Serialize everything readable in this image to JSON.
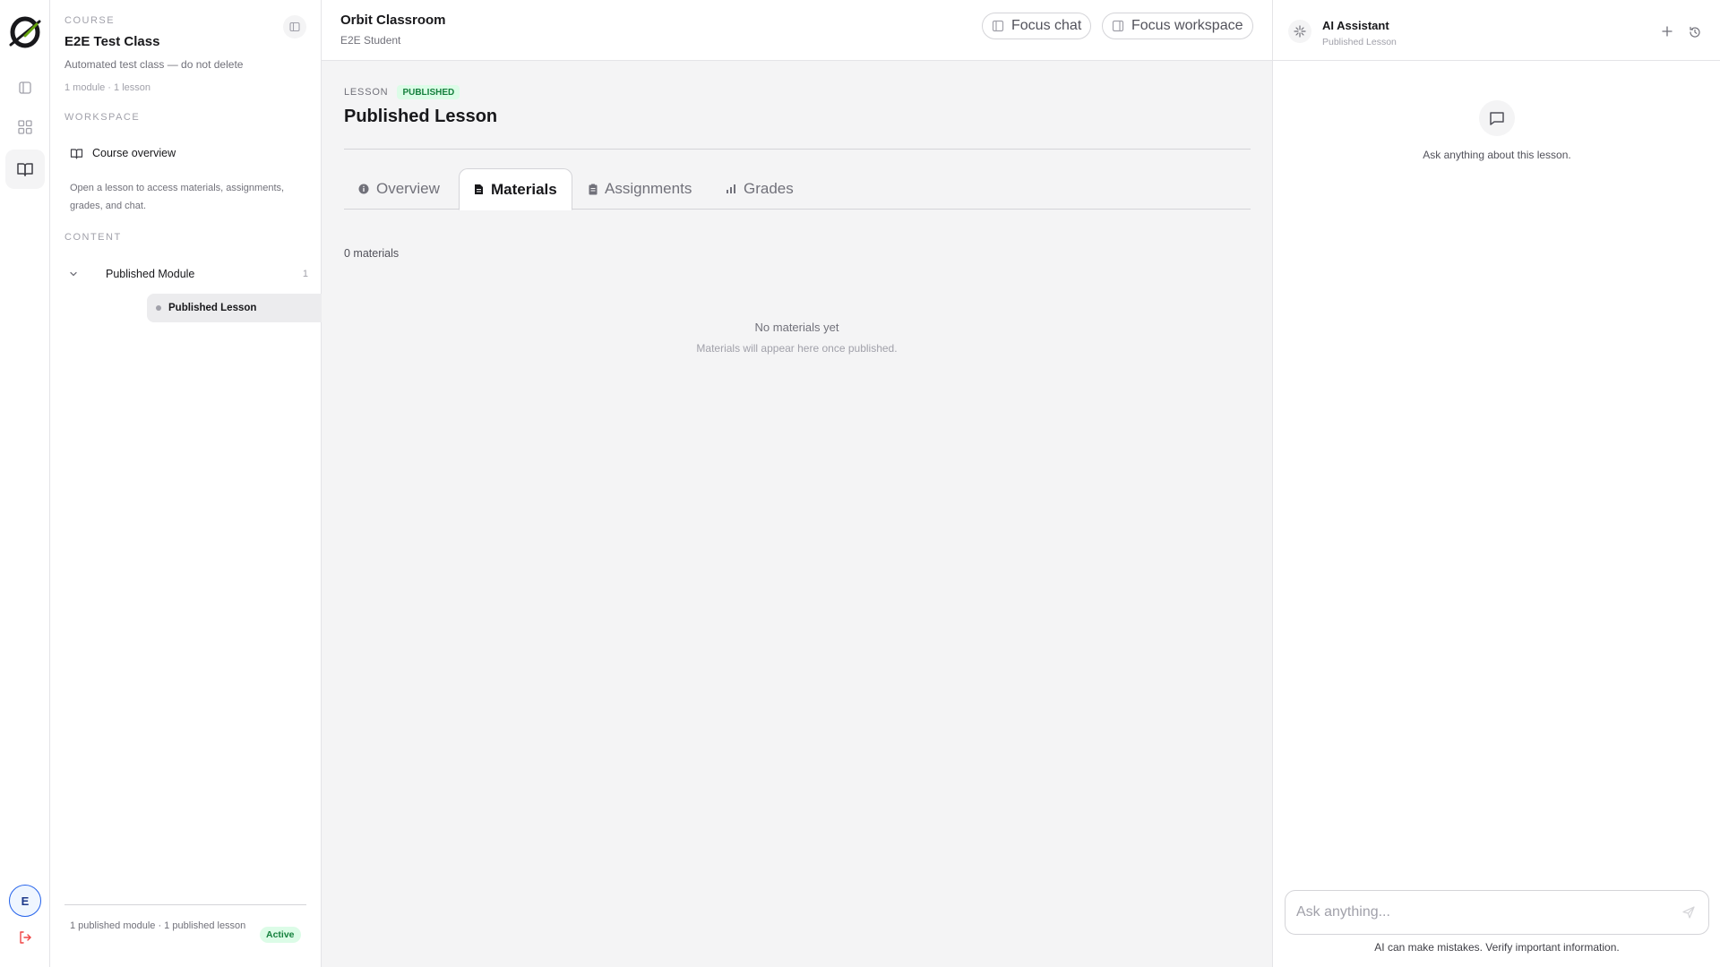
{
  "rail": {
    "icons": [
      "orbit-logo",
      "panel-icon",
      "grid-icon",
      "book-open-icon"
    ],
    "avatar_initial": "E"
  },
  "sidebar": {
    "course_eyebrow": "COURSE",
    "course_title": "E2E Test Class",
    "course_description": "Automated test class — do not delete",
    "course_meta": "1 module · 1 lesson",
    "workspace_eyebrow": "WORKSPACE",
    "course_overview_label": "Course overview",
    "hint": "Open a lesson to access materials, assignments, grades, and chat.",
    "content_eyebrow": "CONTENT",
    "module": {
      "name": "Published Module",
      "count": "1"
    },
    "lesson": {
      "name": "Published Lesson"
    },
    "footer_text": "1 published module · 1 published lesson",
    "status_badge": "Active"
  },
  "header": {
    "title": "Orbit Classroom",
    "subtitle": "E2E Student",
    "focus_chat": "Focus chat",
    "focus_workspace": "Focus workspace"
  },
  "lesson": {
    "eyebrow": "LESSON",
    "status": "PUBLISHED",
    "title": "Published Lesson"
  },
  "tabs": [
    {
      "label": "Overview",
      "icon": "info-icon"
    },
    {
      "label": "Materials",
      "icon": "file-icon",
      "active": true
    },
    {
      "label": "Assignments",
      "icon": "clipboard-icon"
    },
    {
      "label": "Grades",
      "icon": "bar-chart-icon"
    }
  ],
  "materials": {
    "count_text": "0 materials",
    "empty_title": "No materials yet",
    "empty_subtitle": "Materials will appear here once published."
  },
  "ai": {
    "title": "AI Assistant",
    "subtitle": "Published Lesson",
    "empty_text": "Ask anything about this lesson.",
    "input_placeholder": "Ask anything...",
    "disclaimer": "AI can make mistakes. Verify important information."
  },
  "colors": {
    "accent_green": "#15803d",
    "badge_green_bg": "#dcfce7",
    "logout_red": "#ef4444",
    "avatar_blue": "#2563eb"
  }
}
